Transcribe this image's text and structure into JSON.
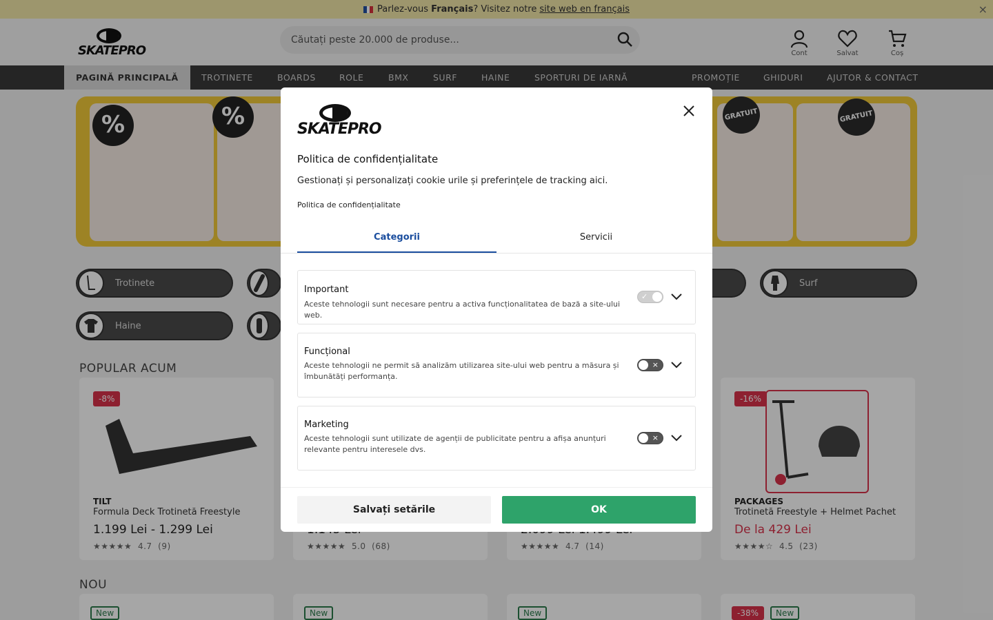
{
  "banner": {
    "text_pre": "Parlez-vous",
    "text_bold": "Français",
    "text_mid": "? Visitez notre",
    "link": "site web en français",
    "close": "×"
  },
  "header": {
    "logo": "SKATEPRO",
    "search_placeholder": "Căutați peste 20.000 de produse...",
    "account_label": "Cont",
    "saved_label": "Salvat",
    "cart_label": "Coș"
  },
  "nav": {
    "items": [
      "PAGINĂ PRINCIPALĂ",
      "TROTINETE",
      "BOARDS",
      "ROLE",
      "BMX",
      "SURF",
      "HAINE",
      "SPORTURI DE IARNĂ",
      "PROMOȚIE",
      "GHIDURI",
      "AJUTOR & CONTACT"
    ]
  },
  "hero": {
    "badge": "%",
    "free_badge": "GRATUIT"
  },
  "categories": {
    "items": [
      "Trotinete",
      "Surf",
      "Haine"
    ]
  },
  "sections": {
    "popular": "POPULAR ACUM",
    "new": "NOU"
  },
  "products": [
    {
      "discount": "-8%",
      "brand": "TILT",
      "name": "Formula Deck Trotinetă Freestyle",
      "price": "1.199 Lei - 1.299 Lei",
      "stars": "★★★★★",
      "rating": "4.7",
      "count": "(9)"
    },
    {
      "discount": "",
      "brand": "",
      "name": "",
      "price": "1.145 Lei",
      "stars": "★★★★★",
      "rating": "5.0",
      "count": "(68)"
    },
    {
      "discount": "",
      "brand": "",
      "name": "",
      "price": "2.099 Lei 1.499 Lei",
      "stars": "★★★★★",
      "rating": "4.7",
      "count": "(14)"
    },
    {
      "discount": "-16%",
      "brand": "PACKAGES",
      "name": "Trotinetă Freestyle + Helmet Pachet",
      "price": "De la 429 Lei",
      "stars": "★★★★☆",
      "rating": "4.5",
      "count": "(23)"
    }
  ],
  "new_tags": {
    "new": "New",
    "discount": "-38%"
  },
  "modal": {
    "logo": "SKATEPRO",
    "title": "Politica de confidențialitate",
    "description": "Gestionați și personalizați cookie urile și preferințele de tracking aici.",
    "policy_link": "Politica de confidențialitate",
    "tabs": [
      "Categorii",
      "Servicii"
    ],
    "categories": [
      {
        "title": "Important",
        "desc": "Aceste tehnologii sunt necesare pentru a activa funcționalitatea de bază a site-ului web.",
        "enabled": true
      },
      {
        "title": "Funcțional",
        "desc": "Aceste tehnologii ne permit să analizăm utilizarea site-ului web pentru a măsura și îmbunătăți performanța.",
        "enabled": false
      },
      {
        "title": "Marketing",
        "desc": "Aceste tehnologii sunt utilizate de agenții de publicitate pentru a afișa anunțuri relevante pentru interesele dvs.",
        "enabled": false
      }
    ],
    "toggle_on_mark": "✓",
    "toggle_off_mark": "×",
    "save_button": "Salvați setările",
    "ok_button": "OK"
  },
  "colors": {
    "accent_blue": "#1a4d9e",
    "ok_green": "#2ea36a",
    "sale_red": "#d9324b",
    "banner_yellow": "#f1e6a8"
  }
}
